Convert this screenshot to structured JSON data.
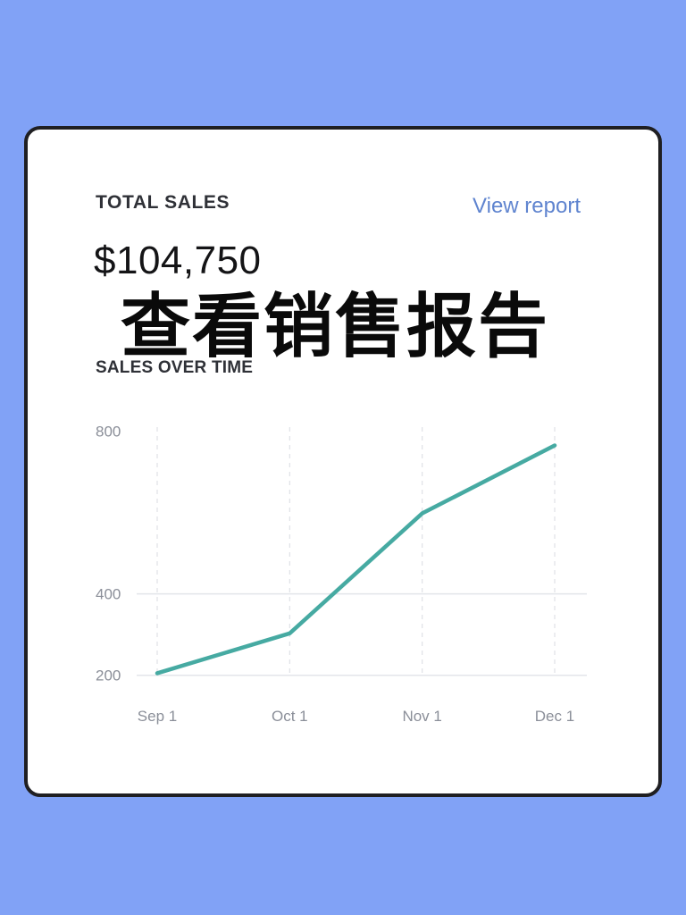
{
  "header": {
    "title": "TOTAL SALES",
    "view_report": "View report",
    "total_value": "$104,750"
  },
  "overlay_caption": "查看销售报告",
  "section_label": "SALES OVER TIME",
  "colors": {
    "background": "#81a2f6",
    "line": "#46aaa2",
    "link": "#5f84cf"
  },
  "chart_data": {
    "type": "line",
    "title": "SALES OVER TIME",
    "categories": [
      "Sep 1",
      "Oct 1",
      "Nov 1",
      "Dec 1"
    ],
    "series": [
      {
        "values": [
          205,
          303,
          598,
          765
        ]
      }
    ],
    "yticks": [
      200,
      400,
      800
    ],
    "ylim": [
      195,
      810
    ],
    "grid": true,
    "xlabel": "",
    "ylabel": ""
  }
}
